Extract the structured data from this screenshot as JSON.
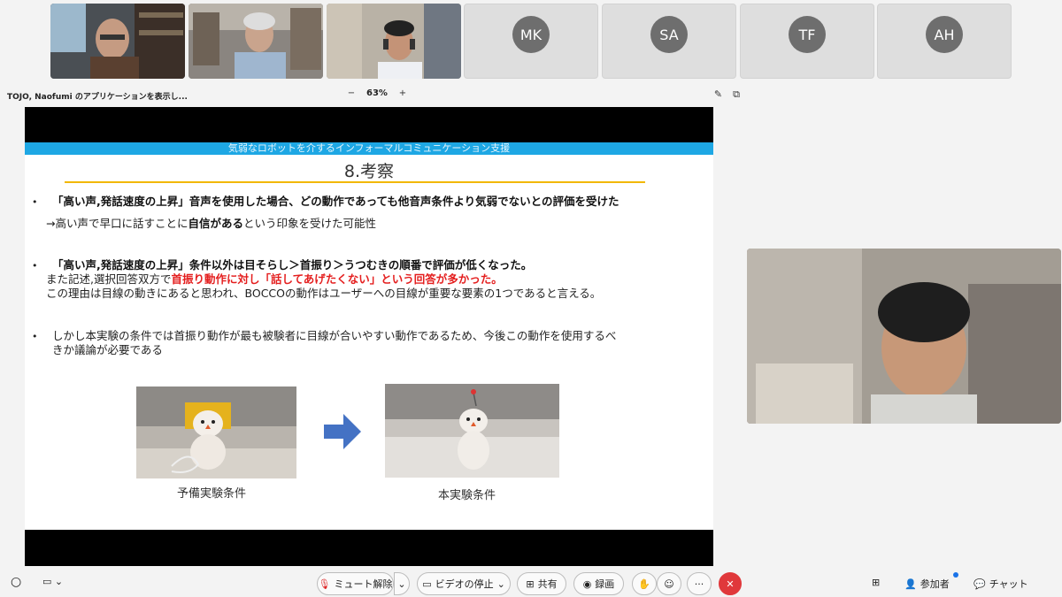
{
  "participants": [
    {
      "type": "video",
      "name": ""
    },
    {
      "type": "video",
      "name": ""
    },
    {
      "type": "video",
      "name": ""
    },
    {
      "type": "initials",
      "initials": "MK"
    },
    {
      "type": "initials",
      "initials": "SA"
    },
    {
      "type": "initials",
      "initials": "TF"
    },
    {
      "type": "initials",
      "initials": "AH"
    }
  ],
  "share": {
    "title": "TOJO, Naofumi のアプリケーションを表示し...",
    "zoom_minus": "−",
    "zoom_level": "63%",
    "zoom_plus": "+"
  },
  "slide": {
    "subtitle": "気弱なロボットを介するインフォーマルコミュニケーション支援",
    "title": "8.考察",
    "bullet1_line1": "「高い声,発話速度の上昇」音声を使用した場合、どの動作であっても他音声条件より気弱でないとの評価を受けた",
    "bullet1_line2_pre": "→高い声で早口に話すことに",
    "bullet1_line2_bold": "自信がある",
    "bullet1_line2_post": "という印象を受けた可能性",
    "bullet2_line1": "「高い声,発話速度の上昇」条件以外は目そらし＞首振り＞うつむきの順番で評価が低くなった。",
    "bullet2_line2_pre": "また記述,選択回答双方で",
    "bullet2_line2_red": "首振り動作に対し「話してあげたくない」という回答が多かった",
    "bullet2_line2_post": "。",
    "bullet2_line3": "この理由は目線の動きにあると思われ、BOCCOの動作はユーザーへの目線が重要な要素の1つであると言える。",
    "bullet3_line1": "しかし本実験の条件では首振り動作が最も被験者に目線が合いやすい動作であるため、今後この動作を使用するべ",
    "bullet3_line2": "きか議論が必要である",
    "caption_left": "予備実験条件",
    "caption_right": "本実験条件"
  },
  "toolbar": {
    "mute": "ミュート解除",
    "video": "ビデオの停止",
    "share": "共有",
    "record": "録画",
    "more": "···",
    "participants": "参加者",
    "chat": "チャット"
  },
  "colors": {
    "accent_blue": "#1ea7e4",
    "title_underline": "#f2b800",
    "highlight_red": "#e41e1e",
    "leave_red": "#e0383b",
    "mute_red": "#d22"
  }
}
